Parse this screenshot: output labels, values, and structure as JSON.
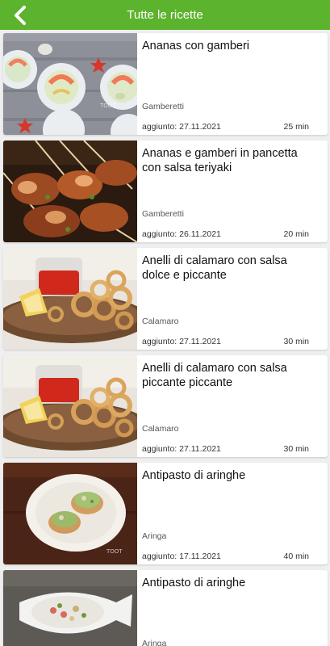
{
  "header": {
    "title": "Tutte le ricette",
    "back_icon": "chevron-left-icon",
    "bar_color": "#5cb32d"
  },
  "recipes": [
    {
      "name": "Ananas con gamberi",
      "category": "Gamberetti",
      "date": "aggiunto: 27.11.2021",
      "time": "25 min",
      "image": "shrimp-pineapple-plates-photo",
      "watermark": "TOOT"
    },
    {
      "name": "Ananas e gamberi in pancetta con salsa teriyaki",
      "category": "Gamberetti",
      "date": "aggiunto: 26.11.2021",
      "time": "20 min",
      "image": "bacon-shrimp-skewers-photo",
      "watermark": ""
    },
    {
      "name": "Anelli di calamaro con salsa dolce e piccante",
      "category": "Calamaro",
      "date": "aggiunto: 27.11.2021",
      "time": "30 min",
      "image": "calamari-rings-sauce-photo",
      "watermark": ""
    },
    {
      "name": "Anelli di calamaro con salsa piccante piccante",
      "category": "Calamaro",
      "date": "aggiunto: 27.11.2021",
      "time": "30 min",
      "image": "calamari-rings-sauce-photo",
      "watermark": ""
    },
    {
      "name": "Antipasto di aringhe",
      "category": "Aringa",
      "date": "aggiunto: 17.11.2021",
      "time": "40 min",
      "image": "herring-toast-plate-photo",
      "watermark": "TOOT"
    },
    {
      "name": "Antipasto di aringhe",
      "category": "Aringa",
      "date": "",
      "time": "",
      "image": "herring-fish-plate-photo",
      "watermark": ""
    }
  ]
}
